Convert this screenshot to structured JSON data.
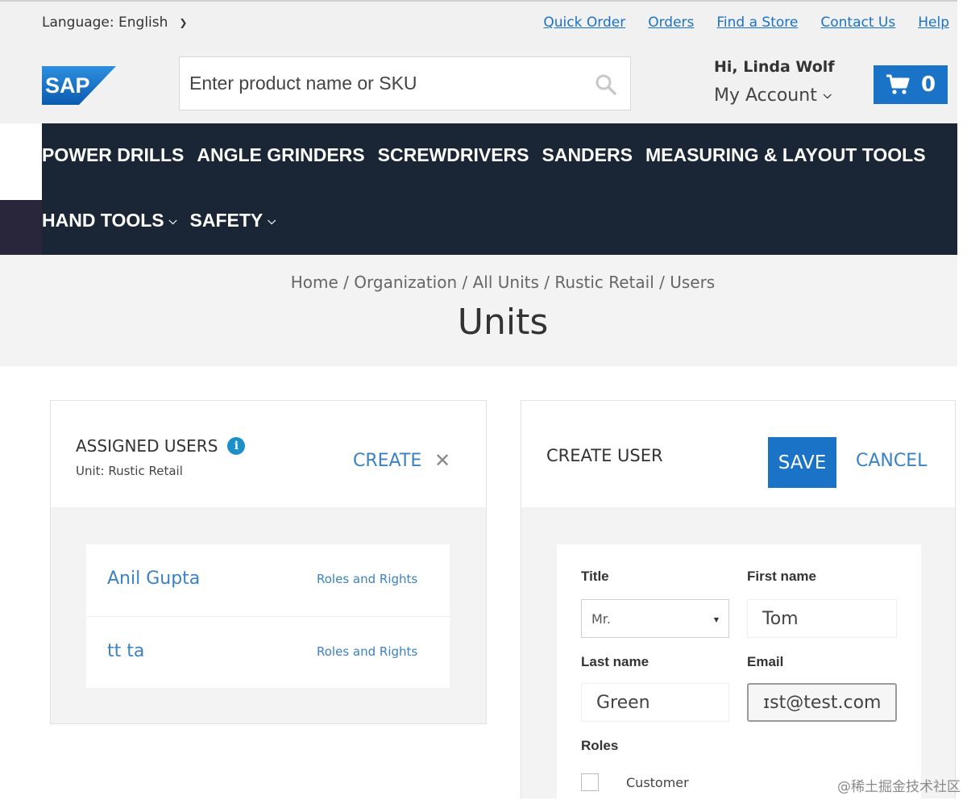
{
  "topbar": {
    "language_label": "Language: English",
    "links": [
      "Quick Order",
      "Orders",
      "Find a Store",
      "Contact Us",
      "Help"
    ]
  },
  "header": {
    "logo_text": "SAP",
    "search_placeholder": "Enter product name or SKU",
    "greeting": "Hi, Linda Wolf",
    "account_label": "My Account",
    "cart_count": "0",
    "brand_color": "#1a73c7"
  },
  "nav": {
    "row1": [
      "POWER DRILLS",
      "ANGLE GRINDERS",
      "SCREWDRIVERS",
      "SANDERS",
      "MEASURING & LAYOUT TOOLS"
    ],
    "row2": [
      "HAND TOOLS",
      "SAFETY"
    ],
    "bg_color": "#1a2535"
  },
  "breadcrumb": [
    "Home",
    "Organization",
    "All Units",
    "Rustic Retail",
    "Users"
  ],
  "page_title": "Units",
  "assigned_users": {
    "title": "ASSIGNED USERS",
    "subtitle": "Unit: Rustic Retail",
    "create_label": "CREATE",
    "users": [
      {
        "name": "Anil Gupta",
        "roles_link": "Roles and Rights"
      },
      {
        "name": "tt ta",
        "roles_link": "Roles and Rights"
      }
    ]
  },
  "create_user": {
    "title": "CREATE USER",
    "save_label": "SAVE",
    "cancel_label": "CANCEL",
    "title_label": "Title",
    "title_value": "Mr.",
    "first_name_label": "First name",
    "first_name_value": "Tom",
    "last_name_label": "Last name",
    "last_name_value": "Green",
    "email_label": "Email",
    "email_value": "ɪst@test.com",
    "roles_label": "Roles",
    "role_customer": "Customer"
  },
  "watermark": "@稀土掘金技术社区"
}
